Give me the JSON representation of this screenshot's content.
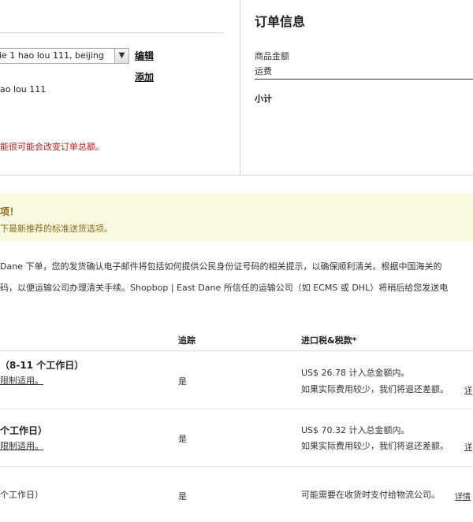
{
  "address": {
    "selected": "ie 1 hao lou 111, beijing",
    "edit_label": "编辑",
    "add_label": "添加",
    "line": "ao lou 111",
    "warning": "能很可能会改变订单总额。"
  },
  "order": {
    "title": "订单信息",
    "goods_amount_label": "商品金额",
    "shipping_label": "运费",
    "subtotal_label": "小计"
  },
  "notice": {
    "title": "项！",
    "text": "下最新推荐的标准送货选项。"
  },
  "paragraph": {
    "line1": "Dane 下单，您的发货确认电子邮件将包括如何提供公民身份证号码的相关提示，以确保顺利清关。根据中国海关的",
    "line2": "码，以便运输公司办理清关手续。Shopbop | East Dane 所信任的运输公司（如 ECMS 或 DHL）将稍后给您发送电"
  },
  "table": {
    "headers": {
      "tracking": "追踪",
      "tax": "进口税&税款*"
    },
    "rows": [
      {
        "name": "（8-11 个工作日）",
        "sub": "限制适用。",
        "tracking": "是",
        "tax_line1": "US$ 26.78 计入总金额内。",
        "tax_line2": "如果实际费用较少，我们将退还差额。",
        "detail": "详"
      },
      {
        "name": "个工作日）",
        "sub": "限制适用。",
        "tracking": "是",
        "tax_line1": "US$ 70.32 计入总金额内。",
        "tax_line2": "如果实际费用较少，我们将退还差额。",
        "detail": "详"
      },
      {
        "name": "个工作日）",
        "sub": "",
        "tracking": "是",
        "tax_line1": "可能需要在收货时支付给物流公司。",
        "tax_line2": "",
        "detail": "详情"
      }
    ]
  },
  "icons": {
    "dropdown": "chevron-down-icon"
  }
}
